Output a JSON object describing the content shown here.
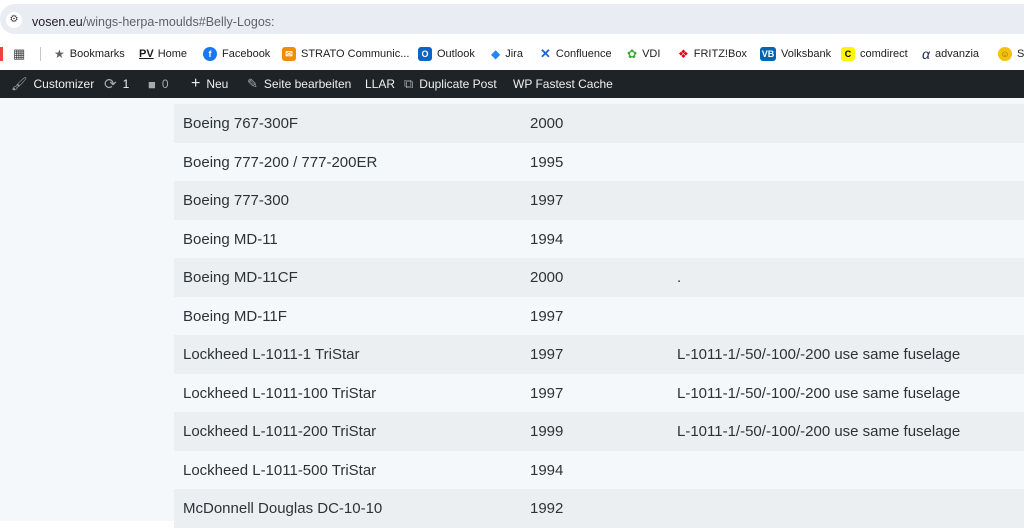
{
  "browser": {
    "url_host": "vosen.eu",
    "url_path": "/wings-herpa-moulds#Belly-Logos:"
  },
  "bookmarks": [
    {
      "label": "Bookmarks",
      "icon": "star-icon",
      "color": "#5f6368"
    },
    {
      "label": "Home",
      "icon": "pv-icon",
      "color": "#1b1b1b"
    },
    {
      "label": "Facebook",
      "icon": "facebook-icon",
      "color": "#1877f2"
    },
    {
      "label": "STRATO Communic...",
      "icon": "strato-icon",
      "color": "#f28c00"
    },
    {
      "label": "Outlook",
      "icon": "outlook-icon",
      "color": "#0a64c2"
    },
    {
      "label": "Jira",
      "icon": "jira-icon",
      "color": "#2684ff"
    },
    {
      "label": "Confluence",
      "icon": "confluence-icon",
      "color": "#1868db"
    },
    {
      "label": "VDI",
      "icon": "vdi-icon",
      "color": "#3aaa35"
    },
    {
      "label": "FRITZ!Box",
      "icon": "fritzbox-icon",
      "color": "#e2001a"
    },
    {
      "label": "Volksbank",
      "icon": "volksbank-icon",
      "color": "#0066b3"
    },
    {
      "label": "comdirect",
      "icon": "comdirect-icon",
      "color": "#fff500"
    },
    {
      "label": "advanzia",
      "icon": "advanzia-icon",
      "color": "#1b2a4a"
    },
    {
      "label": "Se",
      "icon": "smiley-icon",
      "color": "#f4c20d"
    }
  ],
  "wpbar": {
    "customizer": "Customizer",
    "updates": "1",
    "comments": "0",
    "new": "Neu",
    "edit": "Seite bearbeiten",
    "llar": "LLAR",
    "duplicate": "Duplicate Post",
    "cache": "WP Fastest Cache"
  },
  "table": {
    "rows": [
      {
        "model": "Boeing 767-300F",
        "year": "2000",
        "note": ""
      },
      {
        "model": "Boeing 777-200 / 777-200ER",
        "year": "1995",
        "note": ""
      },
      {
        "model": "Boeing 777-300",
        "year": "1997",
        "note": ""
      },
      {
        "model": "Boeing MD-11",
        "year": "1994",
        "note": ""
      },
      {
        "model": "Boeing MD-11CF",
        "year": "2000",
        "note": "."
      },
      {
        "model": "Boeing MD-11F",
        "year": "1997",
        "note": ""
      },
      {
        "model": "Lockheed L-1011-1 TriStar",
        "year": "1997",
        "note": "L-1011-1/-50/-100/-200 use same fuselage"
      },
      {
        "model": "Lockheed L-1011-100 TriStar",
        "year": "1997",
        "note": "L-1011-1/-50/-100/-200 use same fuselage"
      },
      {
        "model": "Lockheed L-1011-200 TriStar",
        "year": "1999",
        "note": "L-1011-1/-50/-100/-200 use same fuselage"
      },
      {
        "model": "Lockheed L-1011-500 TriStar",
        "year": "1994",
        "note": ""
      },
      {
        "model": "McDonnell Douglas DC-10-10",
        "year": "1992",
        "note": ""
      }
    ]
  }
}
